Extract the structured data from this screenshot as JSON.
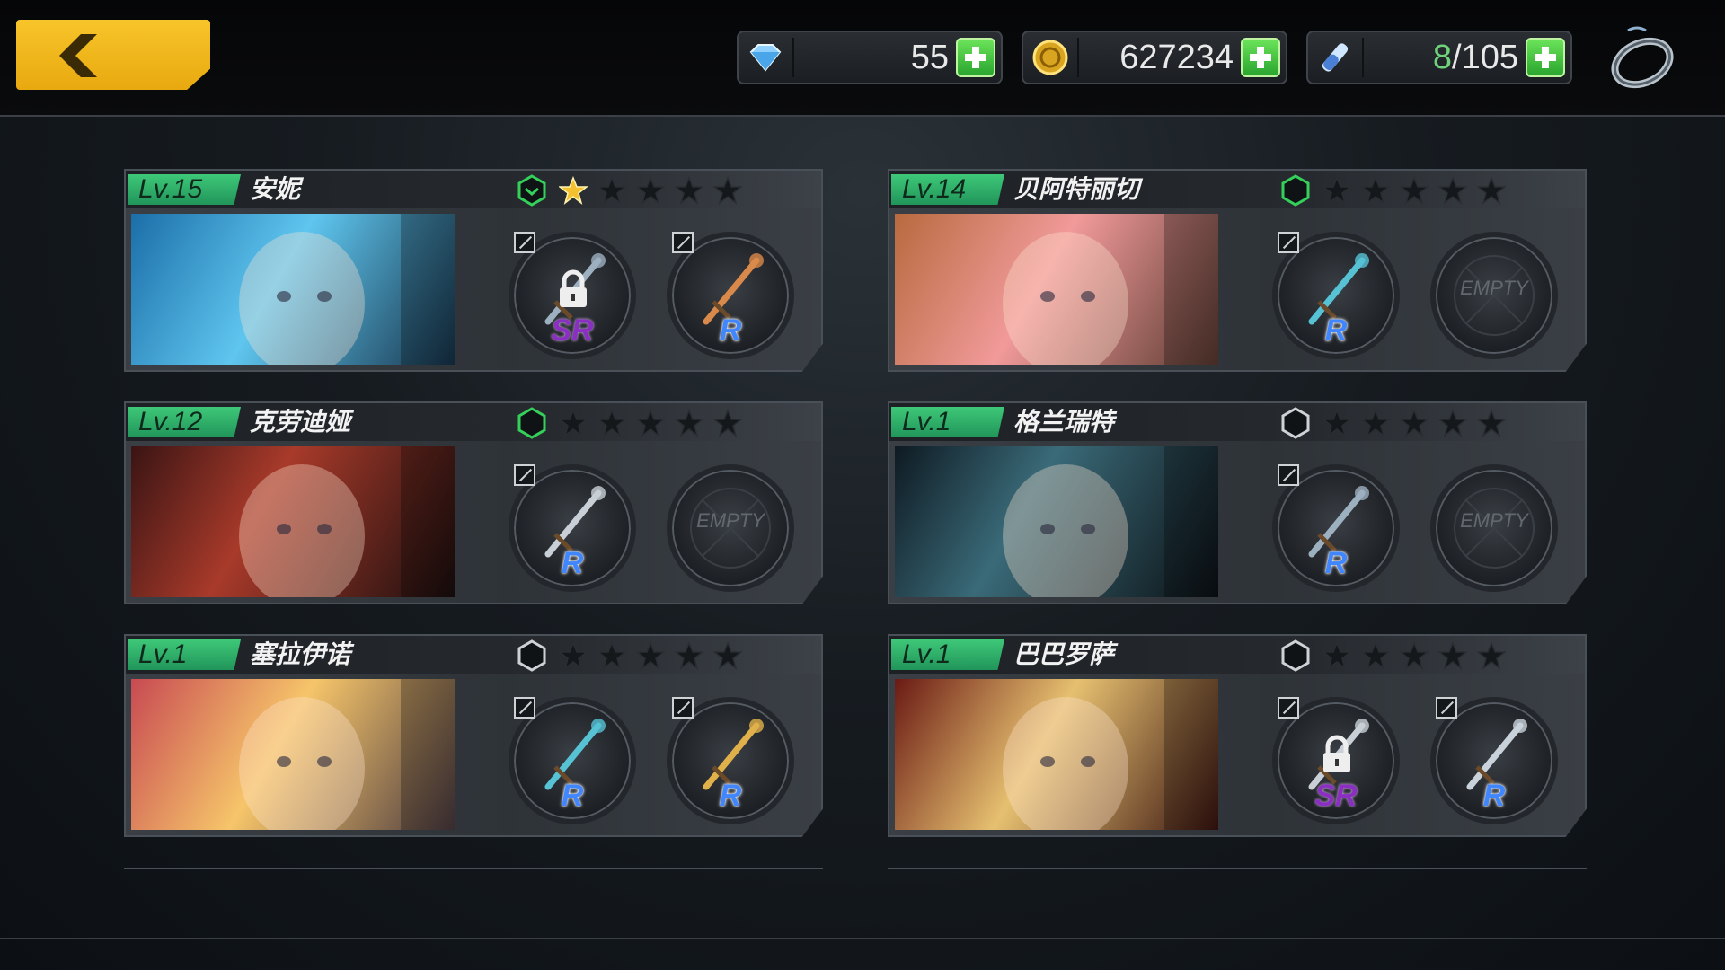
{
  "resources": {
    "gems": "55",
    "gold": "627234",
    "stamina_current": "8",
    "stamina_sep_max": "/105"
  },
  "icons": {
    "back": "back-arrow-icon",
    "gem": "diamond-icon",
    "coin": "coin-icon",
    "potion": "potion-vial-icon",
    "ring": "ring-menu-icon",
    "plus": "plus-icon",
    "lock": "lock-icon"
  },
  "colors": {
    "level_tag": "#2fb56a",
    "back_button": "#f1b81e",
    "plus_button": "#3fc43c",
    "rarity_r": "#3f86ff",
    "rarity_sr": "#8b2fc2"
  },
  "characters": [
    {
      "level": "Lv.15",
      "name": "安妮",
      "stars": 1,
      "hex_active": true,
      "hex_promote": true,
      "slot1": {
        "rarity": "SR",
        "locked": true
      },
      "slot2": {
        "rarity": "R",
        "locked": false
      }
    },
    {
      "level": "Lv.14",
      "name": "贝阿特丽切",
      "stars": 0,
      "hex_active": true,
      "hex_promote": false,
      "slot1": {
        "rarity": "R",
        "locked": false
      },
      "slot2": {
        "empty": "EMPTY"
      }
    },
    {
      "level": "Lv.12",
      "name": "克劳迪娅",
      "stars": 0,
      "hex_active": true,
      "hex_promote": false,
      "slot1": {
        "rarity": "R",
        "locked": false
      },
      "slot2": {
        "empty": "EMPTY"
      }
    },
    {
      "level": "Lv.1",
      "name": "格兰瑞特",
      "stars": 0,
      "hex_active": false,
      "hex_promote": false,
      "slot1": {
        "rarity": "R",
        "locked": false
      },
      "slot2": {
        "empty": "EMPTY"
      }
    },
    {
      "level": "Lv.1",
      "name": "塞拉伊诺",
      "stars": 0,
      "hex_active": false,
      "hex_promote": false,
      "slot1": {
        "rarity": "R",
        "locked": false
      },
      "slot2": {
        "rarity": "R",
        "locked": false
      }
    },
    {
      "level": "Lv.1",
      "name": "巴巴罗萨",
      "stars": 0,
      "hex_active": false,
      "hex_promote": false,
      "slot1": {
        "rarity": "SR",
        "locked": true
      },
      "slot2": {
        "rarity": "R",
        "locked": false
      }
    }
  ]
}
